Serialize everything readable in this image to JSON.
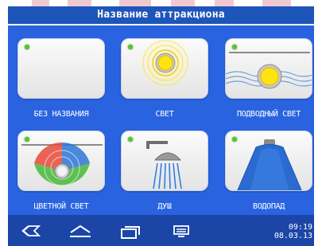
{
  "title": "Название аттракциона",
  "tiles": [
    {
      "label": "БЕЗ НАЗВАНИЯ",
      "icon": "blank-icon",
      "led": "on"
    },
    {
      "label": "СВЕТ",
      "icon": "light-icon",
      "led": "on"
    },
    {
      "label": "ПОДВОДНЫЙ СВЕТ",
      "icon": "underwater-light-icon",
      "led": "on"
    },
    {
      "label": "ЦВЕТНОЙ СВЕТ",
      "icon": "color-light-icon",
      "led": "on"
    },
    {
      "label": "ДУШ",
      "icon": "shower-icon",
      "led": "on"
    },
    {
      "label": "ВОДОПАД",
      "icon": "waterfall-icon",
      "led": "on"
    }
  ],
  "navigation": {
    "back": "back-icon",
    "home": "home-icon",
    "recent": "recent-apps-icon",
    "menu": "menu-icon"
  },
  "clock": {
    "time": "09:19",
    "date": "08.03.13"
  },
  "colors": {
    "title_bar": "#1e55b8",
    "panel": "#2a63e0",
    "bottom_bar": "#1b45a6",
    "led": "#55c433",
    "label": "#ffffff"
  }
}
